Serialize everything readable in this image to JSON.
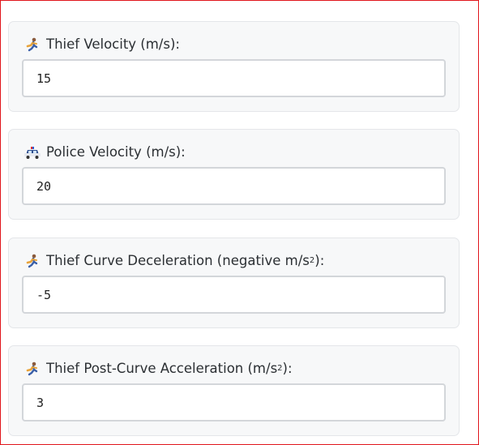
{
  "fields": [
    {
      "icon": "runner-icon",
      "label": "Thief Velocity (m/s):",
      "value": "15"
    },
    {
      "icon": "police-car-icon",
      "label": "Police Velocity (m/s):",
      "value": "20"
    },
    {
      "icon": "runner-icon",
      "label_pre": "Thief Curve Deceleration (negative m/s",
      "label_sup": "2",
      "label_post": "):",
      "value": "-5"
    },
    {
      "icon": "runner-icon",
      "label_pre": "Thief Post-Curve Acceleration (m/s",
      "label_sup": "2",
      "label_post": "):",
      "value": "3"
    }
  ],
  "colors": {
    "frame_border": "#e0161c",
    "card_bg": "#f7f8f9",
    "input_border": "#d3d6da"
  }
}
